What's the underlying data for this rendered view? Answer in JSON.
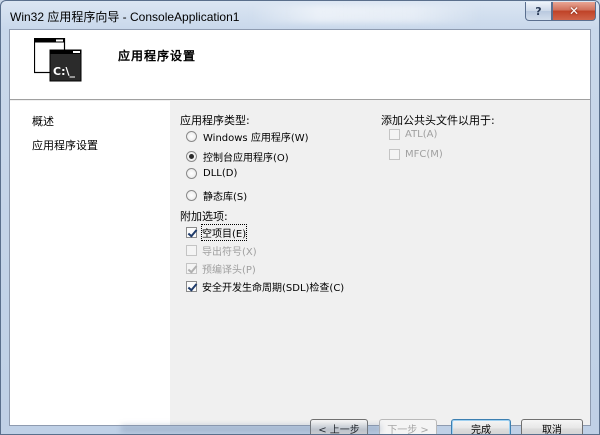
{
  "window": {
    "title": "Win32 应用程序向导 - ConsoleApplication1",
    "help_glyph": "?",
    "close_glyph": "✕"
  },
  "header": {
    "title": "应用程序设置",
    "icon_text": "C:\\_"
  },
  "nav": {
    "items": [
      {
        "label": "概述"
      },
      {
        "label": "应用程序设置"
      }
    ]
  },
  "app_type": {
    "label": "应用程序类型:",
    "options": [
      {
        "label": "Windows 应用程序(W)",
        "checked": false
      },
      {
        "label": "控制台应用程序(O)",
        "checked": true
      },
      {
        "label": "DLL(D)",
        "checked": false
      },
      {
        "label": "静态库(S)",
        "checked": false
      }
    ]
  },
  "extra_options": {
    "label": "附加选项:",
    "items": [
      {
        "label": "空项目(E)",
        "checked": true,
        "enabled": true
      },
      {
        "label": "导出符号(X)",
        "checked": false,
        "enabled": false
      },
      {
        "label": "预编译头(P)",
        "checked": true,
        "enabled": false
      },
      {
        "label": "安全开发生命周期(SDL)检查(C)",
        "checked": true,
        "enabled": true
      }
    ]
  },
  "common_headers": {
    "label": "添加公共头文件以用于:",
    "items": [
      {
        "label": "ATL(A)",
        "checked": false,
        "enabled": false
      },
      {
        "label": "MFC(M)",
        "checked": false,
        "enabled": false
      }
    ]
  },
  "buttons": {
    "prev": "< 上一步",
    "next": "下一步 >",
    "finish": "完成",
    "cancel": "取消"
  }
}
